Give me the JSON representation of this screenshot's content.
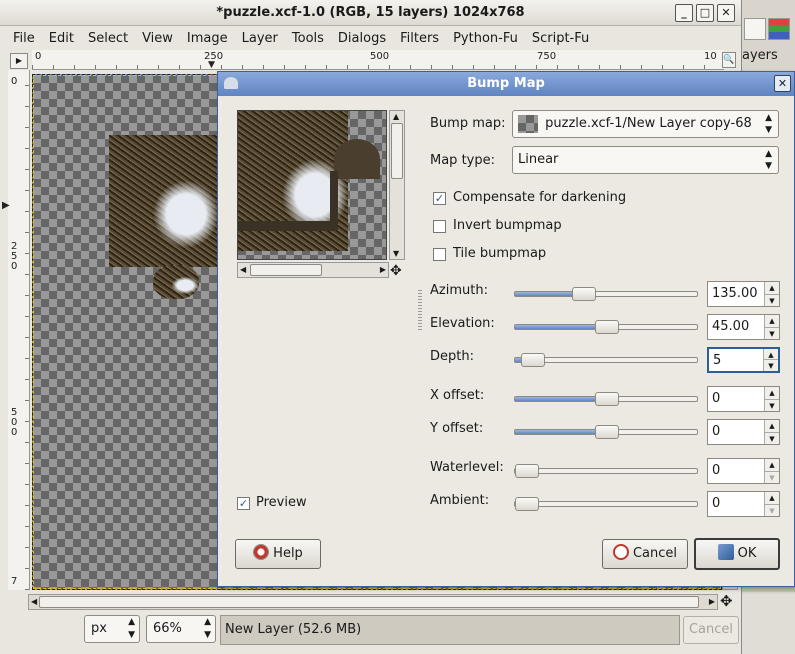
{
  "main_window": {
    "title": "*puzzle.xcf-1.0 (RGB, 15 layers) 1024x768",
    "wm_buttons": [
      "_",
      "□",
      "✕"
    ],
    "menu": [
      "File",
      "Edit",
      "Select",
      "View",
      "Image",
      "Layer",
      "Tools",
      "Dialogs",
      "Filters",
      "Python-Fu",
      "Script-Fu"
    ],
    "ruler_h_labels": [
      "0",
      "250",
      "500",
      "750",
      "10"
    ],
    "ruler_v_labels": [
      "0",
      "2 5 0",
      "5 0 0",
      "7"
    ],
    "status": {
      "unit": "px",
      "zoom": "66%",
      "message": "New Layer (52.6 MB)",
      "cancel_label": "Cancel"
    }
  },
  "toolbox": {
    "layers_label": "ayers"
  },
  "dialog": {
    "title": "Bump Map",
    "bump_map_label": "Bump map:",
    "bump_map_value": "puzzle.xcf-1/New Layer copy-68",
    "map_type_label": "Map type:",
    "map_type_value": "Linear",
    "checkboxes": [
      {
        "label": "Compensate for darkening",
        "checked": true
      },
      {
        "label": "Invert bumpmap",
        "checked": false
      },
      {
        "label": "Tile bumpmap",
        "checked": false
      }
    ],
    "sliders": [
      {
        "label": "Azimuth:",
        "value": "135.00",
        "fraction": 0.375
      },
      {
        "label": "Elevation:",
        "value": "45.00",
        "fraction": 0.5
      },
      {
        "label": "Depth:",
        "value": "5",
        "fraction": 0.1
      },
      {
        "label": "X offset:",
        "value": "0",
        "fraction": 0.5
      },
      {
        "label": "Y offset:",
        "value": "0",
        "fraction": 0.5
      },
      {
        "label": "Waterlevel:",
        "value": "0",
        "fraction": 0.0
      },
      {
        "label": "Ambient:",
        "value": "0",
        "fraction": 0.0
      }
    ],
    "preview_label": "Preview",
    "preview_checked": true,
    "help_label": "Help",
    "cancel_label": "Cancel",
    "ok_label": "OK"
  },
  "colors": {
    "dialog_title_bg": "#6b8fca",
    "slider_fill": "#5f86c4"
  }
}
